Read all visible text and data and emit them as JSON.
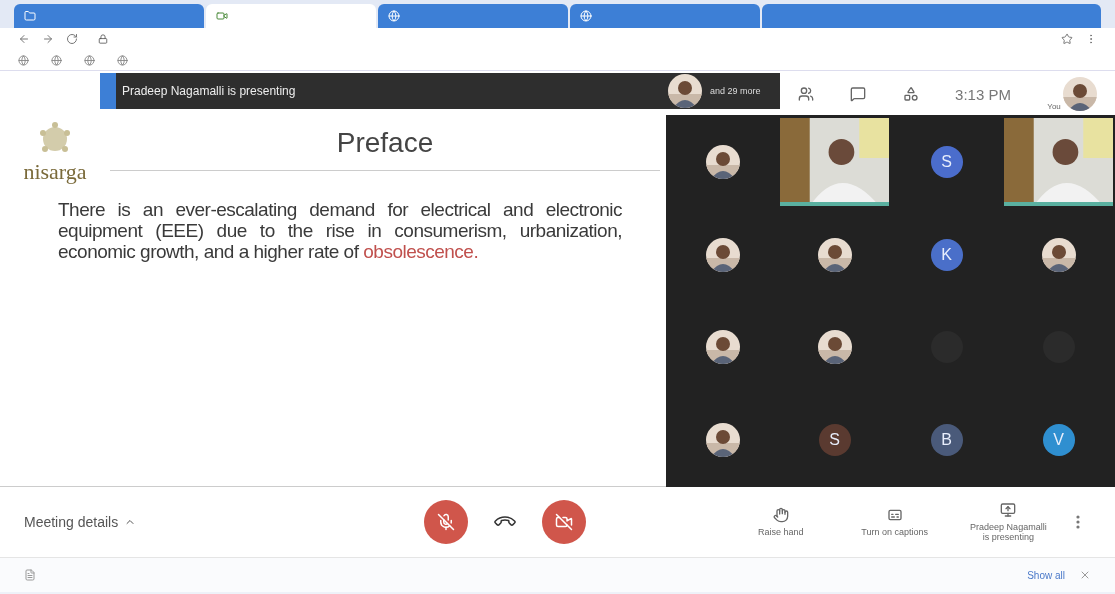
{
  "tabs": [
    {
      "selected": false
    },
    {
      "selected": true
    },
    {
      "selected": false
    },
    {
      "selected": false
    }
  ],
  "presenter_bar": {
    "title": "Pradeep Nagamalli is presenting",
    "others": "and 29 more"
  },
  "info_bar": {
    "time": "3:13 PM",
    "self_label": "You"
  },
  "slide": {
    "logo": "nisarga",
    "title": "Preface",
    "paragraph": "There is an ever-escalating demand for electrical and electronic equipment (EEE) due to the rise in consumerism, urbanization, economic growth, and a higher rate of ",
    "highlight": "obsolescence."
  },
  "tiles": [
    {
      "kind": "avatar"
    },
    {
      "kind": "video"
    },
    {
      "kind": "letter",
      "letter": "S",
      "color": "#4b6dcc"
    },
    {
      "kind": "video"
    },
    {
      "kind": "avatar"
    },
    {
      "kind": "avatar"
    },
    {
      "kind": "letter",
      "letter": "K",
      "color": "#4a6fc9"
    },
    {
      "kind": "avatar"
    },
    {
      "kind": "avatar"
    },
    {
      "kind": "avatar"
    },
    {
      "kind": "blank"
    },
    {
      "kind": "blank"
    },
    {
      "kind": "avatar"
    },
    {
      "kind": "letter",
      "letter": "S",
      "color": "#5a3a30"
    },
    {
      "kind": "letter",
      "letter": "B",
      "color": "#4a5a7a"
    },
    {
      "kind": "letter",
      "letter": "V",
      "color": "#2f8fd0"
    }
  ],
  "controls": {
    "meeting_details": "Meeting details",
    "mic_muted": true,
    "camera_on": false
  },
  "actions": [
    {
      "kind": "hand",
      "label": "Raise hand"
    },
    {
      "kind": "captions",
      "label": "Turn on captions"
    },
    {
      "kind": "present",
      "label": "Pradeep Nagamalli is presenting"
    }
  ],
  "download_bar": {
    "show_all": "Show all"
  }
}
